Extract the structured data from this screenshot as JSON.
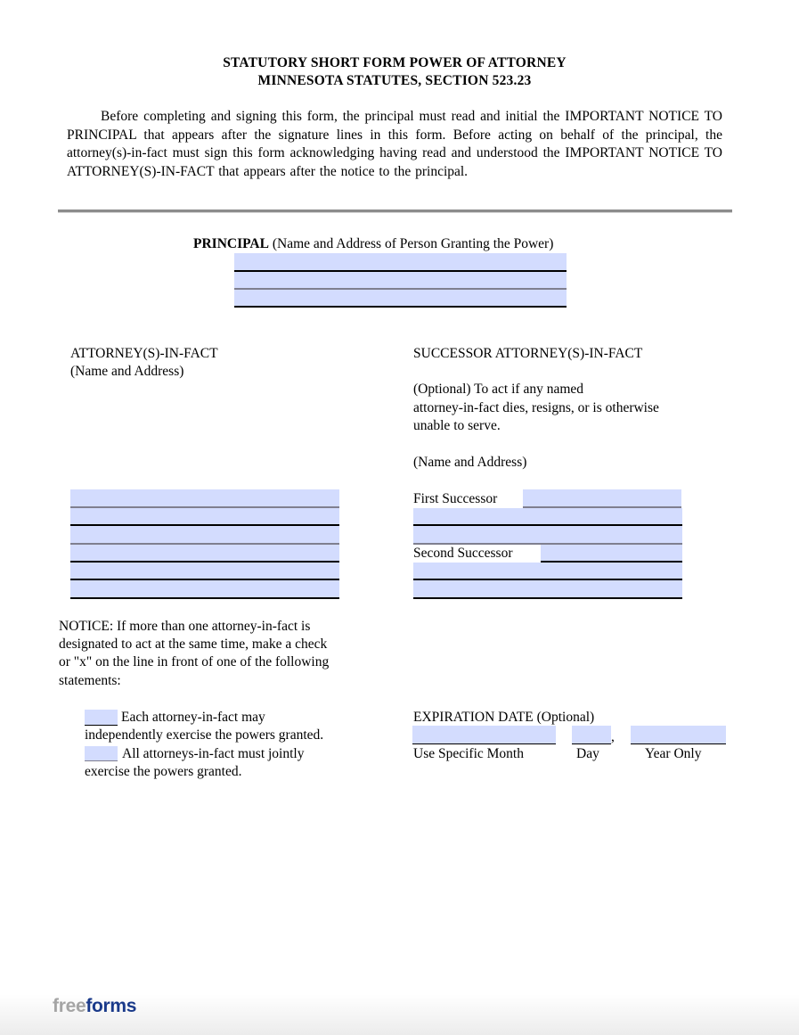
{
  "document": {
    "title_line1": "STATUTORY SHORT FORM POWER OF ATTORNEY",
    "title_line2": "MINNESOTA  STATUTES, SECTION 523.23",
    "intro": "Before completing and signing this form, the principal must read and initial the IMPORTANT NOTICE TO PRINCIPAL that appears after the signature lines in this form. Before acting on behalf of the principal, the attorney(s)-in-fact must sign this form acknowledging having read and understood the IMPORTANT NOTICE TO ATTORNEY(S)-IN-FACT that appears after the notice to the principal."
  },
  "principal": {
    "label": "PRINCIPAL",
    "description": " (Name and Address of Person Granting the Power)",
    "fields": [
      "",
      "",
      ""
    ]
  },
  "attorney_in_fact": {
    "heading": "ATTORNEY(S)-IN-FACT",
    "subheading": "(Name and Address)",
    "fields": [
      "",
      "",
      "",
      "",
      "",
      ""
    ]
  },
  "successor": {
    "heading": "SUCCESSOR  ATTORNEY(S)-IN-FACT",
    "optional_line1": "(Optional)  To  act  if  any  named",
    "optional_line2": "attorney-in-fact  dies,  resigns,  or  is  otherwise",
    "optional_line3": "unable  to  serve.",
    "name_address": "(Name  and  Address)",
    "first_label": "First  Successor",
    "second_label": "Second  Successor",
    "first_fields": [
      "",
      "",
      ""
    ],
    "second_fields": [
      "",
      "",
      ""
    ]
  },
  "notice": {
    "line1": "NOTICE:  If more than one attorney-in-fact is",
    "line2": "designated to act at the same time, make a check",
    "line3": "or \"x\" on the line in front of one of the following",
    "line4": "statements:",
    "option1_line1": "Each attorney-in-fact may",
    "option1_line2": "independently exercise the powers granted.",
    "option2_line1": "All attorneys-in-fact must jointly",
    "option2_line2": "exercise the powers granted.",
    "option1_value": "",
    "option2_value": ""
  },
  "expiration": {
    "heading": "EXPIRATION  DATE",
    "optional": " (Optional)",
    "comma": ",",
    "month_label": "Use Specific Month",
    "day_label": "Day",
    "year_label": "Year Only",
    "month_value": "",
    "day_value": "",
    "year_value": ""
  },
  "footer": {
    "logo_free": "free",
    "logo_forms": "forms"
  }
}
